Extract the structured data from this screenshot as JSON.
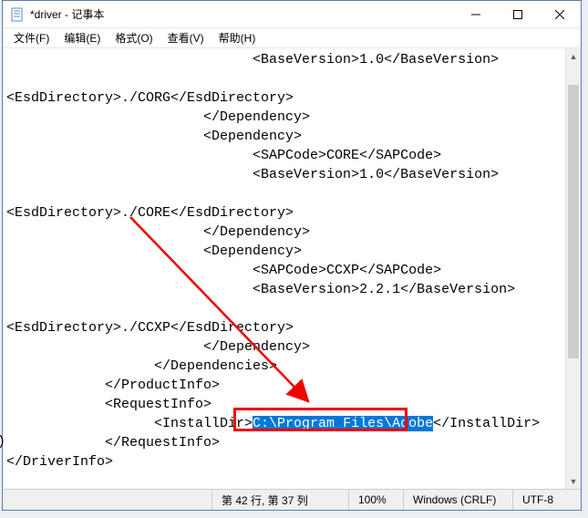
{
  "window": {
    "title": "*driver - 记事本"
  },
  "menu": {
    "file": "文件(F)",
    "edit": "编辑(E)",
    "format": "格式(O)",
    "view": "查看(V)",
    "help": "帮助(H)"
  },
  "content": {
    "l1": "                              <BaseVersion>1.0</BaseVersion>",
    "l2": "",
    "l3": "<EsdDirectory>./CORG</EsdDirectory>",
    "l4": "                        </Dependency>",
    "l5": "                        <Dependency>",
    "l6": "                              <SAPCode>CORE</SAPCode>",
    "l7": "                              <BaseVersion>1.0</BaseVersion>",
    "l8": "",
    "l9": "<EsdDirectory>./CORE</EsdDirectory>",
    "l10": "                        </Dependency>",
    "l11": "                        <Dependency>",
    "l12": "                              <SAPCode>CCXP</SAPCode>",
    "l13": "                              <BaseVersion>2.2.1</BaseVersion>",
    "l14": "",
    "l15": "<EsdDirectory>./CCXP</EsdDirectory>",
    "l16": "                        </Dependency>",
    "l17": "                  </Dependencies>",
    "l18": "            </ProductInfo>",
    "l19": "            <RequestInfo>",
    "l20a": "                  <InstallDir>",
    "l20sel": "C:\\Program Files\\Adobe",
    "l20b": "</InstallDir>",
    "l21": "            </RequestInfo>",
    "l22": "</DriverInfo>",
    "stray": ")"
  },
  "status": {
    "pos": "第 42 行, 第 37 列",
    "zoom": "100%",
    "eol": "Windows (CRLF)",
    "enc": "UTF-8"
  }
}
